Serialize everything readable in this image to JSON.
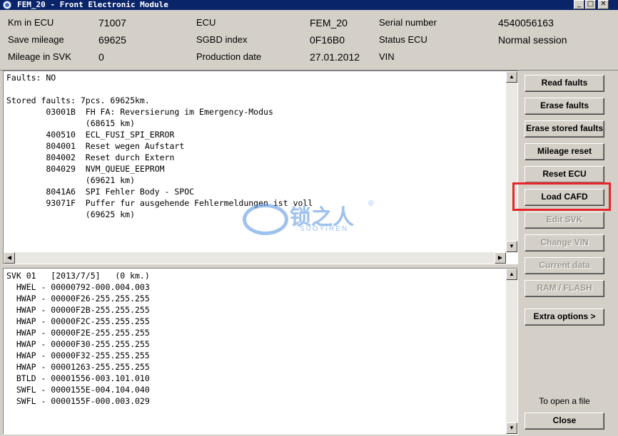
{
  "window": {
    "title": "FEM_20 - Front Electronic Module",
    "min": "_",
    "max": "□",
    "close": "✕"
  },
  "header": {
    "km_in_ecu_label": "Km in ECU",
    "km_in_ecu_value": "71007",
    "save_mileage_label": "Save mileage",
    "save_mileage_value": "69625",
    "mileage_in_svk_label": "Mileage in SVK",
    "mileage_in_svk_value": "0",
    "ecu_label": "ECU",
    "ecu_value": "FEM_20",
    "sgbd_label": "SGBD index",
    "sgbd_value": "0F16B0",
    "production_label": "Production date",
    "production_value": "27.01.2012",
    "serial_label": "Serial number",
    "serial_value": "4540056163",
    "status_label": "Status ECU",
    "status_value": "Normal session",
    "vin_label": "VIN",
    "vin_value": ""
  },
  "faults": {
    "lines": [
      "Faults: NO",
      "",
      "Stored faults: 7pcs. 69625km.",
      "        03001B  FH FA: Reversierung im Emergency-Modus",
      "                (68615 km)",
      "        400510  ECL_FUSI_SPI_ERROR",
      "        804001  Reset wegen Aufstart",
      "        804002  Reset durch Extern",
      "        804029  NVM_QUEUE_EEPROM",
      "                (69621 km)",
      "        8041A6  SPI Fehler Body - SPOC",
      "        93071F  Puffer fur ausgehende Fehlermeldungen ist voll",
      "                (69625 km)"
    ]
  },
  "svk": {
    "lines": [
      "SVK 01   [2013/7/5]   (0 km.)",
      "  HWEL - 00000792-000.004.003",
      "  HWAP - 00000F26-255.255.255",
      "  HWAP - 00000F2B-255.255.255",
      "  HWAP - 00000F2C-255.255.255",
      "  HWAP - 00000F2E-255.255.255",
      "  HWAP - 00000F30-255.255.255",
      "  HWAP - 00000F32-255.255.255",
      "  HWAP - 00001263-255.255.255",
      "  BTLD - 00001556-003.101.010",
      "  SWFL - 0000155E-004.104.040",
      "  SWFL - 0000155F-000.003.029"
    ]
  },
  "buttons": {
    "read_faults": "Read faults",
    "erase_faults": "Erase faults",
    "erase_stored_faults": "Erase stored faults",
    "mileage_reset": "Mileage reset",
    "reset_ecu": "Reset ECU",
    "load_cafd": "Load CAFD",
    "edit_svk": "Edit SVK",
    "change_vin": "Change VIN",
    "current_data": "Current data",
    "ram_flash": "RAM / FLASH",
    "extra_options": "Extra options >",
    "close": "Close"
  },
  "hint": "To open a file",
  "watermark": {
    "text": "锁之人",
    "sub": "SUOYIREN",
    "reg": "®"
  },
  "colors": {
    "title_bar": "#0a246a",
    "highlight": "#e8262a"
  }
}
